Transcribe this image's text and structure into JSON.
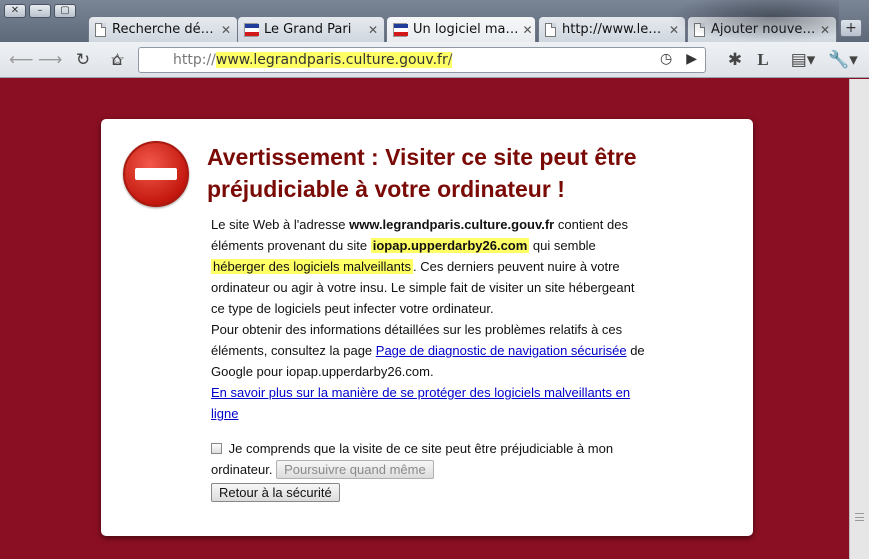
{
  "window": {
    "buttons": [
      "✕",
      "–",
      "▢"
    ]
  },
  "tabs": [
    {
      "label": "Recherche dé…",
      "icon": "doc-icon",
      "active": false
    },
    {
      "label": "Le Grand Pari",
      "icon": "french-flag-icon",
      "active": false
    },
    {
      "label": "Un logiciel ma…",
      "icon": "french-flag-icon",
      "active": true
    },
    {
      "label": "http://www.le…",
      "icon": "doc-icon",
      "active": false
    },
    {
      "label": "Ajouter nouve…",
      "icon": "doc-icon",
      "active": false
    }
  ],
  "toolbar": {
    "url_prefix": "http://",
    "url_host": "www.legrandparis.culture.gouv.fr",
    "url_trail": "/"
  },
  "warning": {
    "title": "Avertissement : Visiter ce site peut être préjudiciable à votre ordinateur !",
    "p1_a": "Le site Web à l'adresse ",
    "p1_host": "www.legrandparis.culture.gouv.fr",
    "p1_b": " contient des éléments provenant du site ",
    "p1_bad_host": "iopap.upperdarby26.com",
    "p1_c": " qui semble ",
    "p1_hl": "héberger des logiciels malveillants",
    "p1_d": ". Ces derniers peuvent nuire à votre ordinateur ou agir à votre insu. Le simple fait de visiter un site hébergeant ce type de logiciels peut infecter votre ordinateur.",
    "p2_a": "Pour obtenir des informations détaillées sur les problèmes relatifs à ces éléments, consultez la page ",
    "p2_link": "Page de diagnostic de navigation sécurisée",
    "p2_b": " de Google pour iopap.upperdarby26.com.",
    "learn_more": "En savoir plus sur la manière de se protéger des logiciels malveillants en ligne",
    "checkbox_label": "Je comprends que la visite de ce site peut être préjudiciable à mon ordinateur.",
    "proceed_button": "Poursuivre quand même",
    "back_button": "Retour à la sécurité"
  }
}
